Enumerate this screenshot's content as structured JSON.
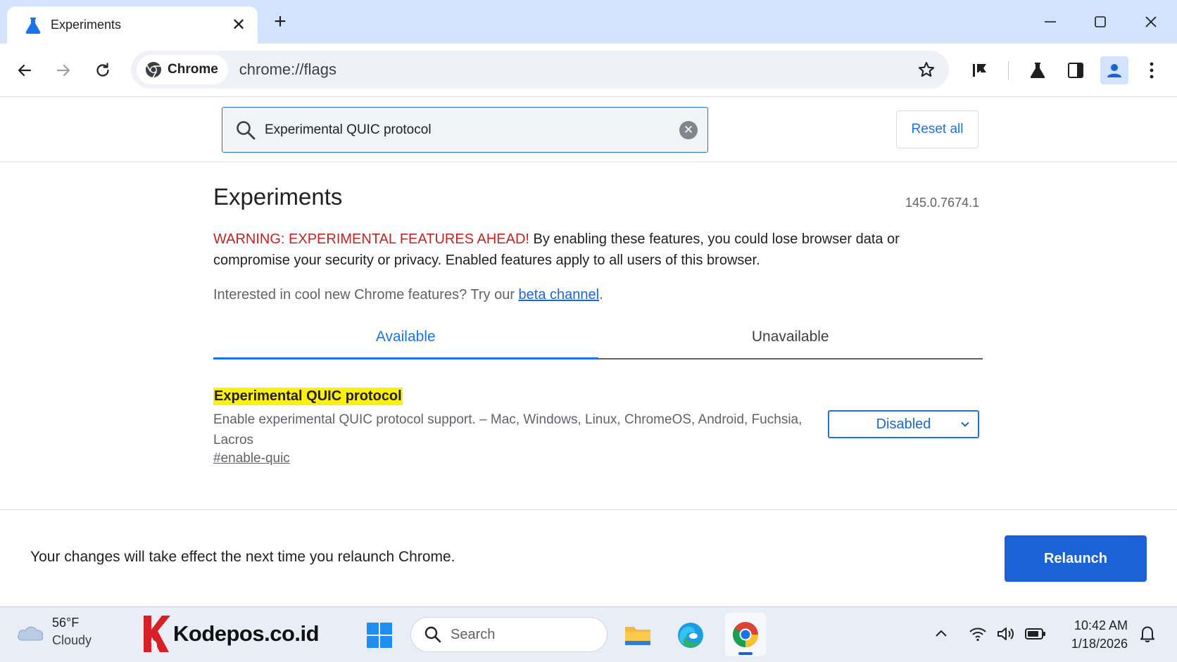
{
  "browser": {
    "tab_title": "Experiments",
    "chip_label": "Chrome",
    "url": "chrome://flags"
  },
  "flags_header": {
    "search_value": "Experimental QUIC protocol",
    "reset_label": "Reset all"
  },
  "main": {
    "title": "Experiments",
    "version": "145.0.7674.1",
    "warning_red": "WARNING: EXPERIMENTAL FEATURES AHEAD!",
    "warning_text": " By enabling these features, you could lose browser data or compromise your security or privacy. Enabled features apply to all users of this browser.",
    "promo_text": "Interested in cool new Chrome features? Try our ",
    "promo_link": "beta channel",
    "promo_end": ".",
    "tabs": [
      {
        "label": "Available",
        "active": true
      },
      {
        "label": "Unavailable",
        "active": false
      }
    ],
    "flag": {
      "name": "Experimental QUIC protocol",
      "description": "Enable experimental QUIC protocol support. – Mac, Windows, Linux, ChromeOS, Android, Fuchsia, Lacros",
      "link": "#enable-quic",
      "selected": "Disabled"
    }
  },
  "relaunch": {
    "message": "Your changes will take effect the next time you relaunch Chrome.",
    "button_label": "Relaunch"
  },
  "taskbar": {
    "weather_temp": "56°F",
    "weather_cond": "Cloudy",
    "brand_text": "Kodepos.co.id",
    "search_label": "Search",
    "time": "10:42 AM",
    "date": "1/18/2026"
  },
  "colors": {
    "accent": "#1a73e8",
    "warning_red": "#c5221f",
    "highlight": "#fff200",
    "relaunch_button": "#1a62d6",
    "tabstrip": "#d3e3fd"
  },
  "icons": [
    "flask-icon",
    "close-icon",
    "plus-icon",
    "minimize-icon",
    "maximize-icon",
    "back-icon",
    "forward-icon",
    "reload-icon",
    "chrome-logo-icon",
    "star-icon",
    "reading-list-icon",
    "labs-icon",
    "side-panel-icon",
    "profile-icon",
    "more-icon",
    "search-icon",
    "clear-icon",
    "chevron-down-icon",
    "cloud-icon",
    "windows-start-icon",
    "file-explorer-icon",
    "edge-icon",
    "chrome-icon",
    "chevron-up-icon",
    "wifi-icon",
    "volume-icon",
    "battery-icon",
    "bell-icon"
  ]
}
